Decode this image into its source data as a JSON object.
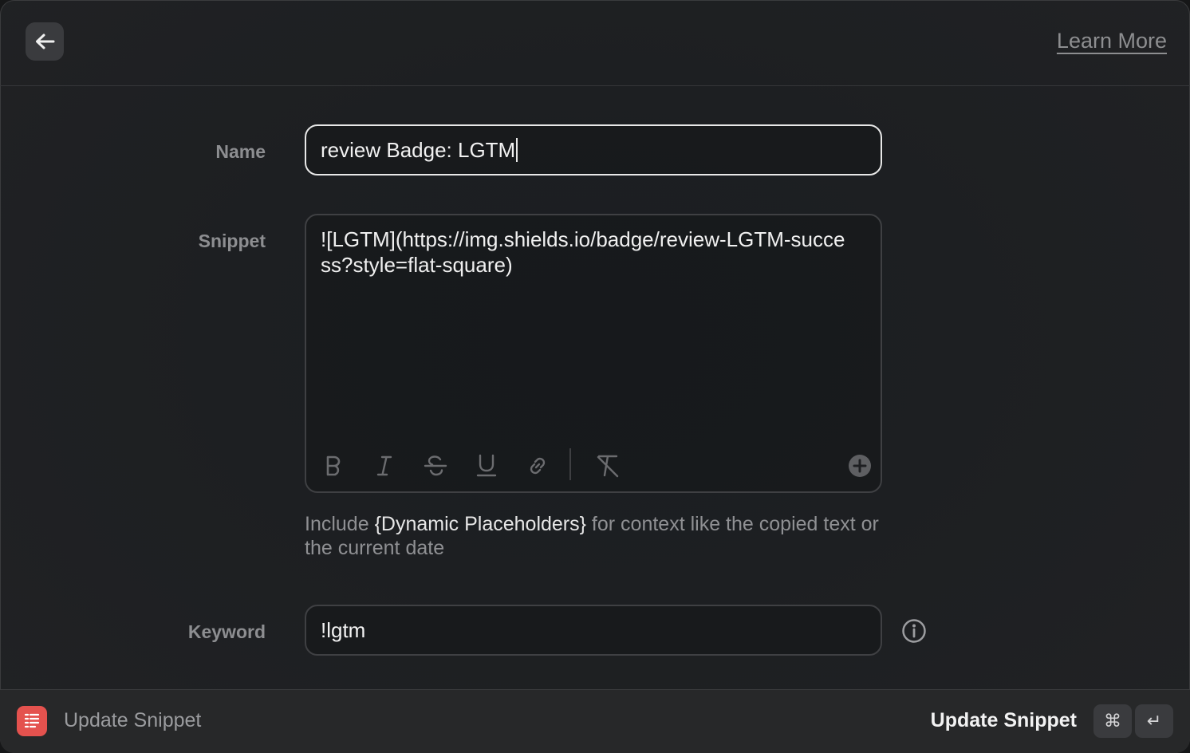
{
  "header": {
    "back_icon": "arrow-left-icon",
    "learn_more": "Learn More"
  },
  "form": {
    "name": {
      "label": "Name",
      "value": "review Badge: LGTM"
    },
    "snippet": {
      "label": "Snippet",
      "value": "![LGTM](https://img.shields.io/badge/review-LGTM-success?style=flat-square)",
      "toolbar": [
        "bold-icon",
        "italic-icon",
        "strikethrough-icon",
        "underline-icon",
        "link-icon",
        "clear-formatting-icon",
        "add-placeholder-icon"
      ]
    },
    "help": {
      "prefix": "Include ",
      "placeholder": "{Dynamic Placeholders}",
      "suffix": " for context like the copied text or the current date"
    },
    "keyword": {
      "label": "Keyword",
      "value": "!lgtm",
      "info_icon": "info-icon"
    }
  },
  "footer": {
    "app_icon": "snippets-icon",
    "title": "Update Snippet",
    "action_label": "Update Snippet",
    "shortcut_keys": [
      "⌘",
      "↵"
    ]
  },
  "colors": {
    "background": "#1d1f22",
    "accent_icon": "#e4524e",
    "text_primary": "#f2f2f2",
    "text_secondary": "#8d8e91"
  }
}
